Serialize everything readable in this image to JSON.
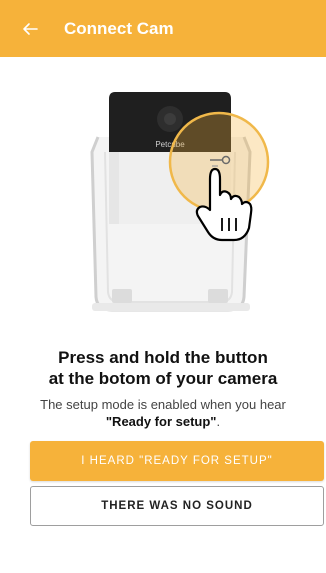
{
  "colors": {
    "accent": "#f6b23a",
    "background": "#ffffff",
    "text": "#111111"
  },
  "appbar": {
    "back_icon": "arrow-left-icon",
    "title": "Connect Cam"
  },
  "illustration": {
    "brand_text": "Petcube",
    "hand_icon": "pointing-hand-icon"
  },
  "content": {
    "headline_line1": "Press and hold the button",
    "headline_line2": "at the botom of your camera",
    "sub_text": "The setup mode is enabled when you hear",
    "sub_bold": "\"Ready for setup\"",
    "sub_end": "."
  },
  "buttons": {
    "primary_label": "I HEARD \"READY FOR SETUP\"",
    "secondary_label": "THERE WAS NO SOUND"
  }
}
